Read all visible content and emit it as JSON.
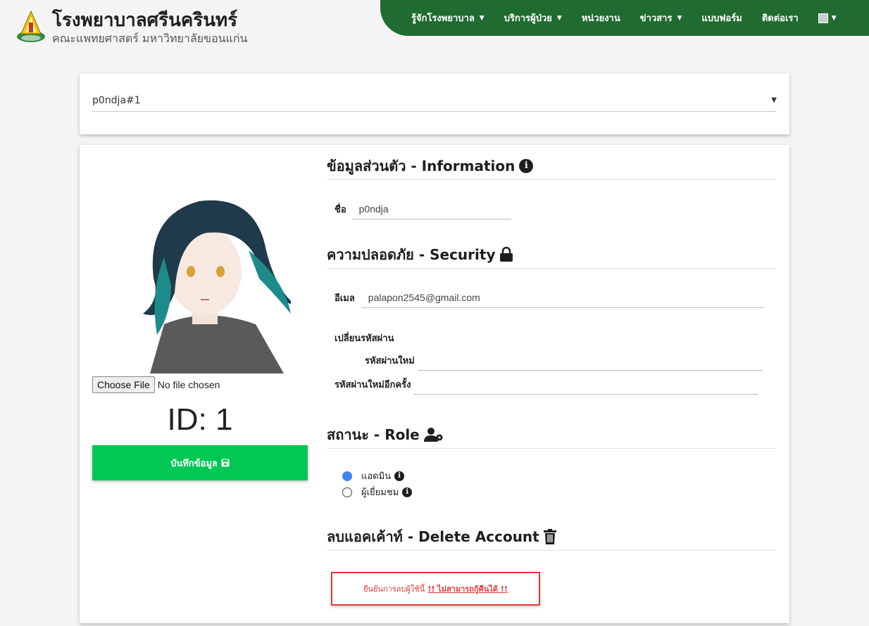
{
  "brand": {
    "title": "โรงพยาบาลศรีนครินทร์",
    "subtitle": "คณะแพทยศาสตร์ มหาวิทยาลัยขอนแก่น"
  },
  "nav": {
    "items": [
      {
        "label": "รู้จักโรงพยาบาล",
        "dropdown": true
      },
      {
        "label": "บริการผู้ป่วย",
        "dropdown": true
      },
      {
        "label": "หน่วยงาน",
        "dropdown": false
      },
      {
        "label": "ข่าวสาร",
        "dropdown": true
      },
      {
        "label": "แบบฟอร์ม",
        "dropdown": false
      },
      {
        "label": "ติดต่อเรา",
        "dropdown": false
      }
    ]
  },
  "user_select": {
    "value": "p0ndja#1"
  },
  "profile": {
    "file_button": "Choose File",
    "file_status": "No file chosen",
    "id_text": "ID: 1",
    "save_label": "บันทึกข้อมูล"
  },
  "info": {
    "heading": "ข้อมูลส่วนตัว - Information",
    "name_label": "ชื่อ",
    "name_value": "p0ndja"
  },
  "security": {
    "heading": "ความปลอดภัย - Security",
    "email_label": "อีเมล",
    "email_value": "palapon2545@gmail.com",
    "change_password_label": "เปลี่ยนรหัสผ่าน",
    "new_password_label": "รหัสผ่านใหม่",
    "confirm_password_label": "รหัสผ่านใหม่อีกครั้ง"
  },
  "role": {
    "heading": "สถานะ - Role",
    "options": [
      {
        "label": "แอดมิน",
        "selected": true
      },
      {
        "label": "ผู้เยี่ยมชม",
        "selected": false
      }
    ]
  },
  "delete": {
    "heading": "ลบแอคเค้าท์ - Delete Account",
    "button_text": "ยืนยันการลบผู้ใช้นี้",
    "button_warning": "!! ไม่สามารถกู้คืนได้ !!"
  },
  "colors": {
    "nav_bg": "#1f6b30",
    "save_bg": "#00c853",
    "delete_red": "#e53935",
    "radio_selected": "#4285f4"
  }
}
